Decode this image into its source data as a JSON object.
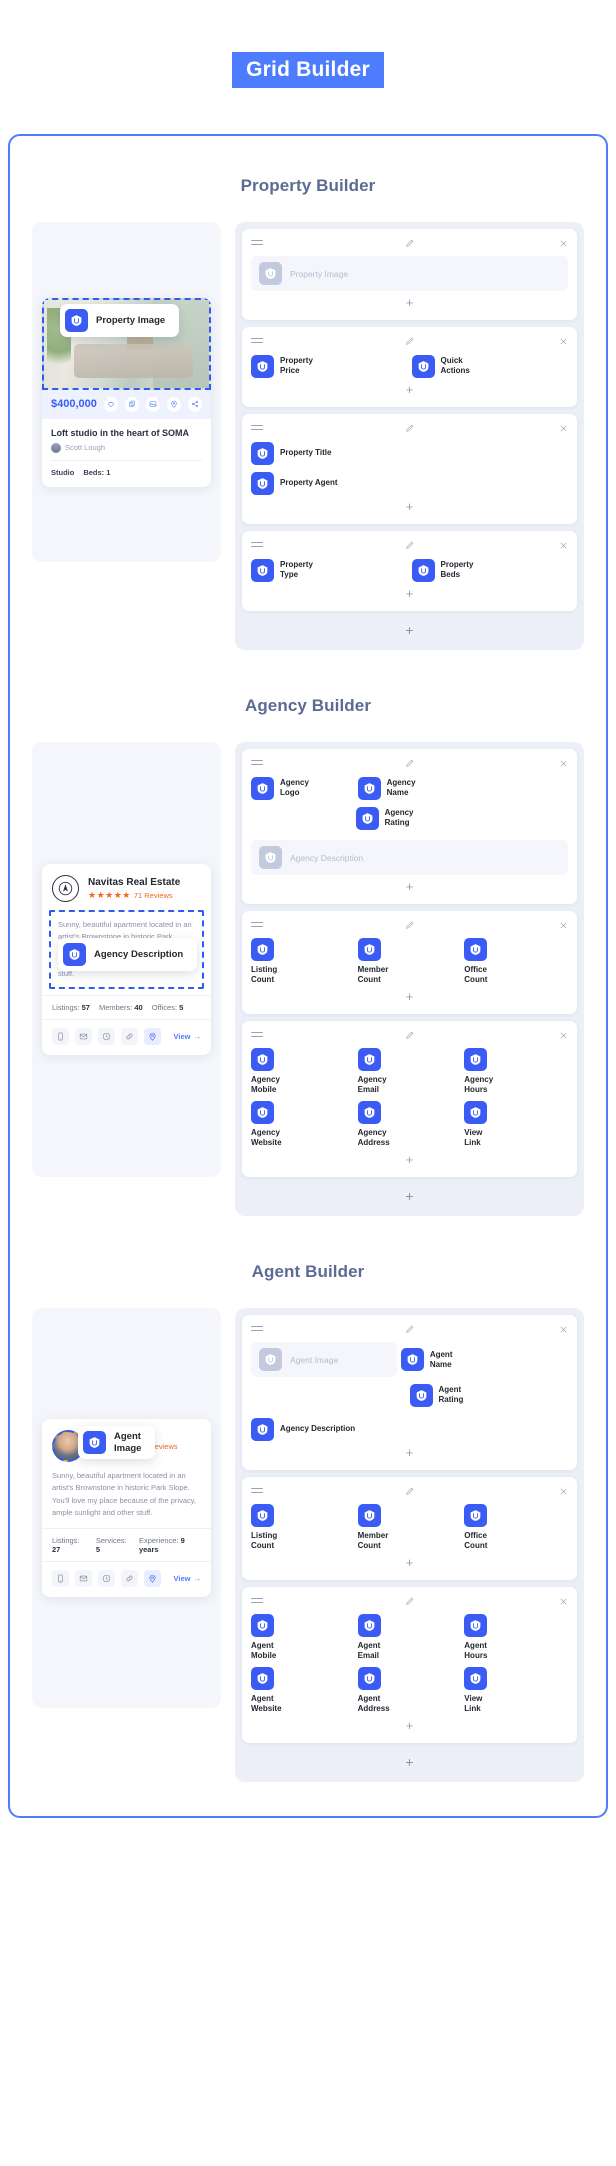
{
  "page": {
    "title": "Grid Builder"
  },
  "icons": {
    "drag": "drag-handle-icon",
    "edit": "pencil-icon",
    "close": "close-icon",
    "add": "+"
  },
  "property": {
    "section_title": "Property Builder",
    "tag_label": "Property Image",
    "card": {
      "price": "$400,000",
      "title": "Loft studio in the heart of SOMA",
      "agent": "Scott Lough",
      "meta": [
        "Studio",
        "Beds: 1"
      ]
    },
    "groups": [
      {
        "placeholder": "Property Image",
        "items": []
      },
      {
        "items": [
          {
            "label": "Property\nPrice"
          },
          {
            "label": "Quick\nActions"
          }
        ]
      },
      {
        "items": [
          {
            "label": "Property Title"
          },
          {
            "label": "Property Agent"
          }
        ]
      },
      {
        "items": [
          {
            "label": "Property\nType"
          },
          {
            "label": "Property\nBeds"
          }
        ]
      }
    ]
  },
  "agency": {
    "section_title": "Agency Builder",
    "tag_label": "Agency Description",
    "card": {
      "name": "Navitas Real Estate",
      "stars": "★★★★★",
      "reviews": "71 Reviews",
      "description": "Sunny, beautiful apartment located in an artist's Brownstone in historic Park Slope. You'll love my place because of the privacy, ample sunlight and other stuff.",
      "stats": [
        {
          "label": "Listings:",
          "value": "57"
        },
        {
          "label": "Members:",
          "value": "40"
        },
        {
          "label": "Offices:",
          "value": "5"
        }
      ],
      "view_label": "View"
    },
    "groups": [
      {
        "items": [
          {
            "label": "Agency\nLogo"
          },
          {
            "label": "Agency\nName"
          },
          {
            "label": "Agency\nRating"
          }
        ],
        "placeholder": "Agency Description"
      },
      {
        "items": [
          {
            "label": "Listing\nCount"
          },
          {
            "label": "Member\nCount"
          },
          {
            "label": "Office\nCount"
          }
        ]
      },
      {
        "items": [
          {
            "label": "Agency\nMobile"
          },
          {
            "label": "Agency\nEmail"
          },
          {
            "label": "Agency\nHours"
          },
          {
            "label": "Agency\nWebsite"
          },
          {
            "label": "Agency\nAddress"
          },
          {
            "label": "View\nLink"
          }
        ]
      }
    ]
  },
  "agent": {
    "section_title": "Agent Builder",
    "tag_label": "Agent\nImage",
    "card": {
      "stars": "★★★★★",
      "reviews": "31 Reviews",
      "description": "Sunny, beautiful apartment located in an artist's Brownstone in historic Park Slope. You'll love my place because of the privacy, ample sunlight and other stuff.",
      "stats": [
        {
          "label": "Listings:",
          "value": "27"
        },
        {
          "label": "Services:",
          "value": "5"
        },
        {
          "label": "Experience:",
          "value": "9 years"
        }
      ],
      "view_label": "View"
    },
    "groups": [
      {
        "placeholder": "Agent\nImage",
        "items": [
          {
            "label": "Agent\nName"
          },
          {
            "label": "Agent\nRating"
          }
        ],
        "full_item": {
          "label": "Agency Description"
        }
      },
      {
        "items": [
          {
            "label": "Listing\nCount"
          },
          {
            "label": "Member\nCount"
          },
          {
            "label": "Office\nCount"
          }
        ]
      },
      {
        "items": [
          {
            "label": "Agent\nMobile"
          },
          {
            "label": "Agent\nEmail"
          },
          {
            "label": "Agent\nHours"
          },
          {
            "label": "Agent\nWebsite"
          },
          {
            "label": "Agent\nAddress"
          },
          {
            "label": "View\nLink"
          }
        ]
      }
    ]
  },
  "colors": {
    "brand_blue": "#3b5bf5",
    "accent_blue": "#4d7cfe",
    "title_slate": "#5c6b94",
    "star_orange": "#f2652a",
    "panel_bg": "#eceff7"
  }
}
